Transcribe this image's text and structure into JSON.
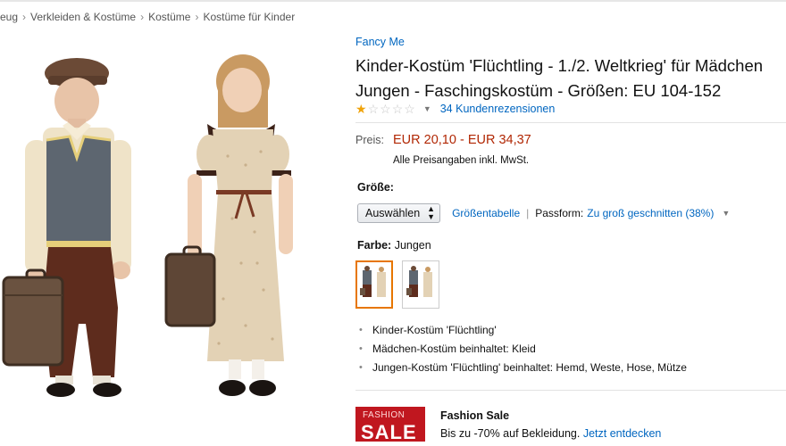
{
  "breadcrumb": {
    "items": [
      "eug",
      "Verkleiden & Kostüme",
      "Kostüme",
      "Kostüme für Kinder"
    ],
    "separator": "›"
  },
  "product": {
    "brand": "Fancy Me",
    "title_lines": [
      "Kinder-Kostüm 'Flüchtling - 1./2. Weltkrieg' für Mädchen",
      "Jungen - Faschingskostüm - Größen: EU 104-152"
    ],
    "rating": {
      "stars_filled": 1,
      "stars_total": 5,
      "reviews_link": "34 Kundenrezensionen"
    },
    "price": {
      "label": "Preis:",
      "value": "EUR 20,10 - EUR 34,37",
      "note": "Alle Preisangaben inkl. MwSt."
    },
    "size": {
      "label": "Größe:",
      "select_value": "Auswählen",
      "size_chart_link": "Größentabelle",
      "fit_label": "Passform:",
      "fit_link": "Zu groß geschnitten (38%)"
    },
    "color": {
      "label": "Farbe:",
      "value": "Jungen",
      "swatch_count": 2,
      "selected_index": 0
    },
    "bullets": [
      "Kinder-Kostüm 'Flüchtling'",
      "Mädchen-Kostüm beinhaltet: Kleid",
      "Jungen-Kostüm 'Flüchtling' beinhaltet: Hemd, Weste, Hose, Mütze"
    ]
  },
  "ad": {
    "logo_small": "FASHION",
    "logo_big": "SALE",
    "title": "Fashion Sale",
    "text": "Bis zu -70% auf Bekleidung.",
    "link": "Jetzt entdecken"
  },
  "colors": {
    "link": "#0066c0",
    "price": "#b12704",
    "star": "#f0a30a",
    "selected_border": "#e77600",
    "sale_red": "#c0171f"
  },
  "icons": [
    "star-icon",
    "chevron-down-icon",
    "select-arrows-icon",
    "bullet-icon"
  ]
}
